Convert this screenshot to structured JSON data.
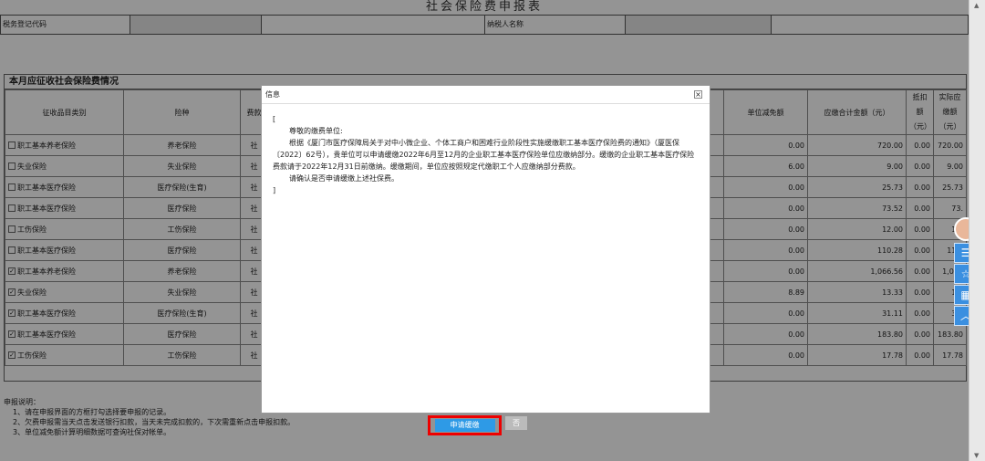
{
  "title": "社会保险费申报表",
  "header": {
    "tax_code_label": "税务登记代码",
    "taxpayer_label": "纳税人名称"
  },
  "section_title": "本月应征收社会保险费情况",
  "columns": {
    "category": "征收品目类别",
    "insurance": "险种",
    "fee": "费款",
    "unit_reduction": "单位减免额",
    "total": "应缴合计金额（元）",
    "deduction": "抵扣额（元）",
    "actual": "实际应缴额（元）"
  },
  "rows": [
    {
      "checked": false,
      "category": "职工基本养老保险",
      "insurance": "养老保险",
      "fee": "社",
      "reduction": "0.00",
      "total": "720.00",
      "deduction": "0.00",
      "actual": "720.00"
    },
    {
      "checked": false,
      "category": "失业保险",
      "insurance": "失业保险",
      "fee": "社",
      "reduction": "6.00",
      "total": "9.00",
      "deduction": "0.00",
      "actual": "9.00"
    },
    {
      "checked": false,
      "category": "职工基本医疗保险",
      "insurance": "医疗保险(生育)",
      "fee": "社",
      "reduction": "0.00",
      "total": "25.73",
      "deduction": "0.00",
      "actual": "25.73"
    },
    {
      "checked": false,
      "category": "职工基本医疗保险",
      "insurance": "医疗保险",
      "fee": "社",
      "reduction": "0.00",
      "total": "73.52",
      "deduction": "0.00",
      "actual": "73."
    },
    {
      "checked": false,
      "category": "工伤保险",
      "insurance": "工伤保险",
      "fee": "社",
      "reduction": "0.00",
      "total": "12.00",
      "deduction": "0.00",
      "actual": "12."
    },
    {
      "checked": false,
      "category": "职工基本医疗保险",
      "insurance": "医疗保险",
      "fee": "社",
      "reduction": "0.00",
      "total": "110.28",
      "deduction": "0.00",
      "actual": "110."
    },
    {
      "checked": true,
      "category": "职工基本养老保险",
      "insurance": "养老保险",
      "fee": "社",
      "reduction": "0.00",
      "total": "1,066.56",
      "deduction": "0.00",
      "actual": "1,066"
    },
    {
      "checked": true,
      "category": "失业保险",
      "insurance": "失业保险",
      "fee": "社",
      "reduction": "8.89",
      "total": "13.33",
      "deduction": "0.00",
      "actual": "13."
    },
    {
      "checked": true,
      "category": "职工基本医疗保险",
      "insurance": "医疗保险(生育)",
      "fee": "社",
      "reduction": "0.00",
      "total": "31.11",
      "deduction": "0.00",
      "actual": "31."
    },
    {
      "checked": true,
      "category": "职工基本医疗保险",
      "insurance": "医疗保险",
      "fee": "社",
      "reduction": "0.00",
      "total": "183.80",
      "deduction": "0.00",
      "actual": "183.80"
    },
    {
      "checked": true,
      "category": "工伤保险",
      "insurance": "工伤保险",
      "fee": "社",
      "reduction": "0.00",
      "total": "17.78",
      "deduction": "0.00",
      "actual": "17.78"
    }
  ],
  "notes": {
    "heading": "申报说明：",
    "line1": "1、请在申报界面的方框打勾选择要申报的记录。",
    "line2": "2、欠费申报需当天点击发送银行扣款，当天未完成扣款的，下次需重新点击申报扣款。",
    "line3": "3、单位减免额计算明细数据可查询社保对帐单。"
  },
  "dialog": {
    "title": "信息",
    "close": "×",
    "open_bracket": "[",
    "greeting": "尊敬的缴费单位:",
    "para1": "根据《厦门市医疗保障局关于对中小微企业、个体工商户和困难行业阶段性实施缓缴职工基本医疗保险费的通知》（厦医保〔2022〕62号），贵单位可以申请缓缴2022年6月至12月的企业职工基本医疗保险单位应缴纳部分。缓缴的企业职工基本医疗保险费款请于2022年12月31日前缴纳。缓缴期间，单位应按照规定代缴职工个人应缴纳部分费款。",
    "para2": "请确认是否申请缓缴上述社保费。",
    "close_bracket": "]",
    "apply_button": "申请缓缴",
    "no_button": "否"
  },
  "side_tools": {
    "tool1": "☰",
    "tool2": "☆",
    "tool3": "▦",
    "tool4": "︿"
  }
}
